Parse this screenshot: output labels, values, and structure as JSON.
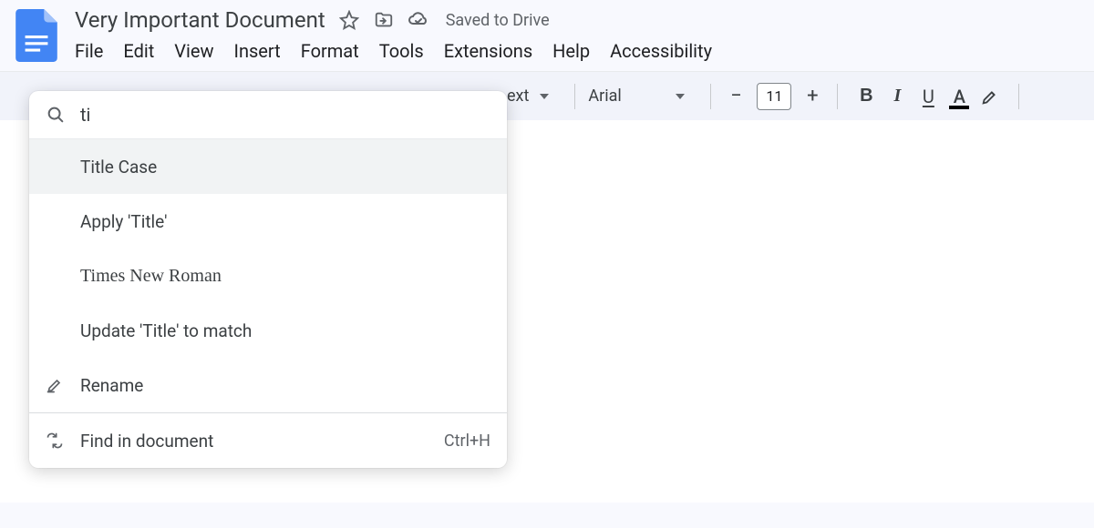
{
  "header": {
    "title": "Very Important Document",
    "saved_text": "Saved to Drive"
  },
  "menu": [
    "File",
    "Edit",
    "View",
    "Insert",
    "Format",
    "Tools",
    "Extensions",
    "Help",
    "Accessibility"
  ],
  "toolbar": {
    "text_fragment": "ext",
    "font": "Arial",
    "size": "11"
  },
  "search": {
    "query": "ti",
    "results": [
      {
        "label": "Title Case",
        "highlighted": true
      },
      {
        "label": "Apply 'Title'"
      },
      {
        "label": "Times New Roman",
        "serif": true
      },
      {
        "label": "Update 'Title' to match"
      },
      {
        "label": "Rename",
        "icon": "rename"
      }
    ],
    "find": {
      "label": "Find in document",
      "shortcut": "Ctrl+H"
    }
  }
}
